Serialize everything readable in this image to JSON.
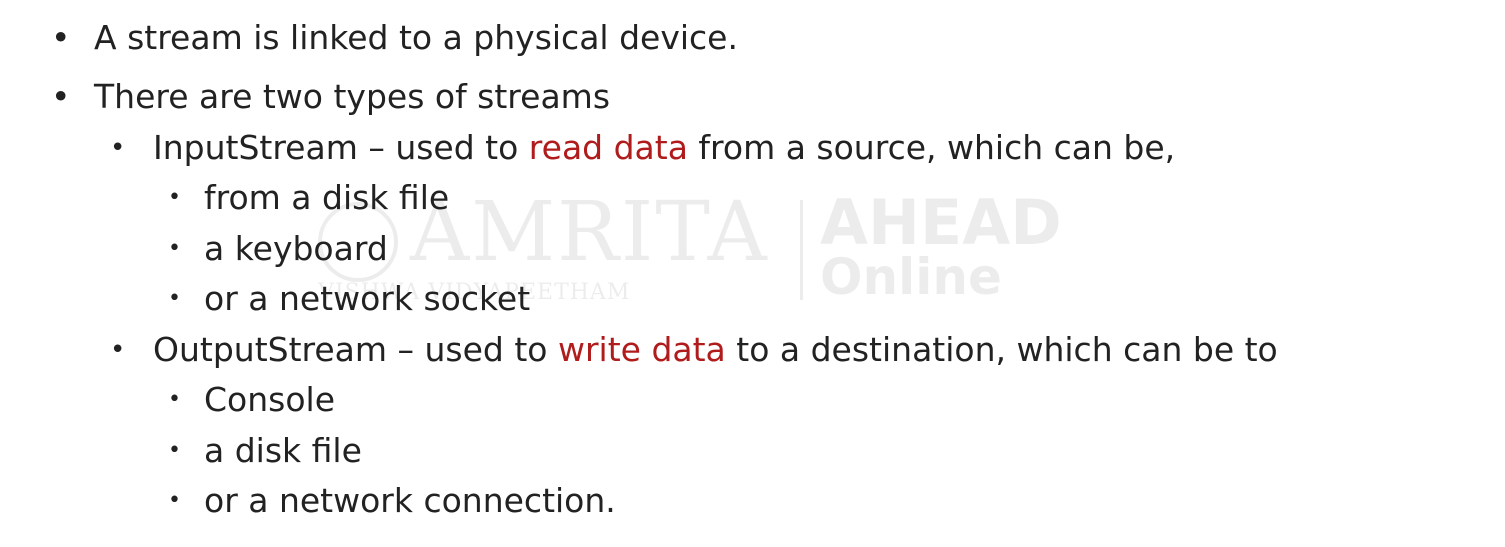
{
  "bullets": {
    "b1": "A stream is linked to a physical device.",
    "b2": "There are two types of streams",
    "input": {
      "before": "InputStream – used to ",
      "highlight": "read data",
      "after": " from a source, which can be,"
    },
    "input_items": [
      "from a disk file",
      "a keyboard",
      "or a network socket"
    ],
    "output": {
      "before": "OutputStream – used to ",
      "highlight": "write data",
      "after": " to a destination, which can be to"
    },
    "output_items": [
      "Console",
      "a disk file",
      "or a network connection."
    ]
  },
  "bullet_glyph": "•",
  "colors": {
    "text": "#222222",
    "highlight": "#b01c1c"
  },
  "watermark": {
    "left_text": "AMRITA",
    "left_subtext": "VISHWA VIDYAPEETHAM",
    "right_text": "AHEAD",
    "right_subtext": "Online"
  }
}
